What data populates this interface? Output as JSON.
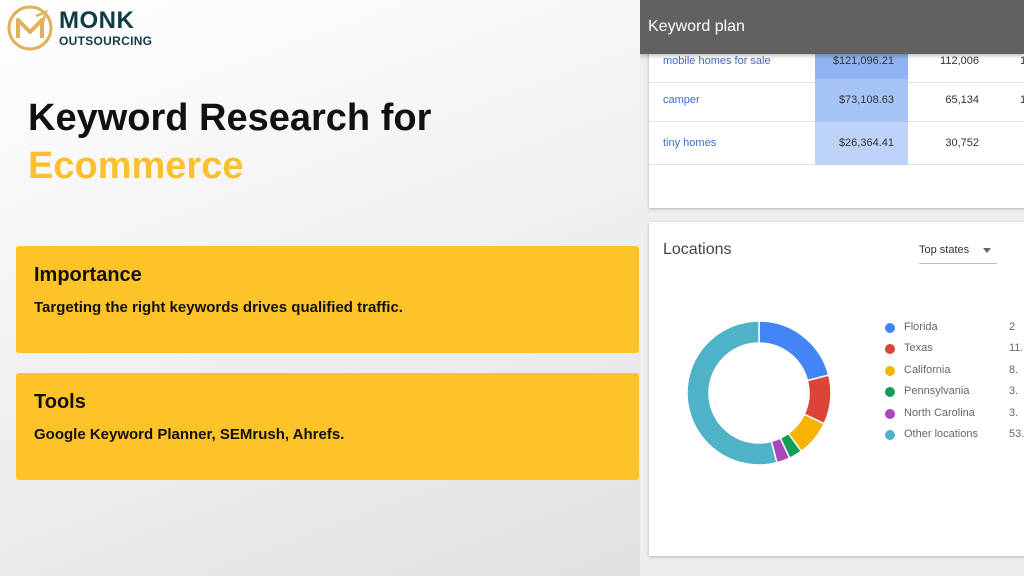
{
  "logo": {
    "brand": "MONK",
    "sub": "OUTSOURCING",
    "icon": "monk-m-logo-icon"
  },
  "title": {
    "line1": "Keyword Research for",
    "line2": "Ecommerce"
  },
  "cards": [
    {
      "title": "Importance",
      "body": "Targeting the right keywords drives qualified traffic."
    },
    {
      "title": "Tools",
      "body": "Google Keyword Planner, SEMrush, Ahrefs."
    }
  ],
  "keyword_plan": {
    "header": "Keyword plan",
    "rows": [
      {
        "keyword": "mobile homes for sale",
        "bid": "$121,096.21",
        "volume": "112,006",
        "extra": "1"
      },
      {
        "keyword": "camper",
        "bid": "$73,108.63",
        "volume": "65,134",
        "extra": "1"
      },
      {
        "keyword": "tiny homes",
        "bid": "$26,364.41",
        "volume": "30,752",
        "extra": ""
      }
    ]
  },
  "locations": {
    "title": "Locations",
    "filter": "Top states",
    "filter_icon": "dropdown-caret-icon",
    "legend": [
      {
        "name": "Florida",
        "pct": "2",
        "color": "#4285f4"
      },
      {
        "name": "Texas",
        "pct": "11.",
        "color": "#db4437"
      },
      {
        "name": "California",
        "pct": "8.",
        "color": "#f4b400"
      },
      {
        "name": "Pennsylvania",
        "pct": "3.",
        "color": "#0f9d58"
      },
      {
        "name": "North Carolina",
        "pct": "3.",
        "color": "#ab47bc"
      },
      {
        "name": "Other locations",
        "pct": "53.",
        "color": "#4eb3c7"
      }
    ]
  },
  "chart_data": {
    "type": "pie",
    "categories": [
      "Florida",
      "Texas",
      "California",
      "Pennsylvania",
      "North Carolina",
      "Other locations"
    ],
    "values": [
      21,
      11,
      8,
      3,
      3,
      54
    ],
    "colors": [
      "#4285f4",
      "#db4437",
      "#f4b400",
      "#0f9d58",
      "#ab47bc",
      "#4eb3c7"
    ]
  }
}
